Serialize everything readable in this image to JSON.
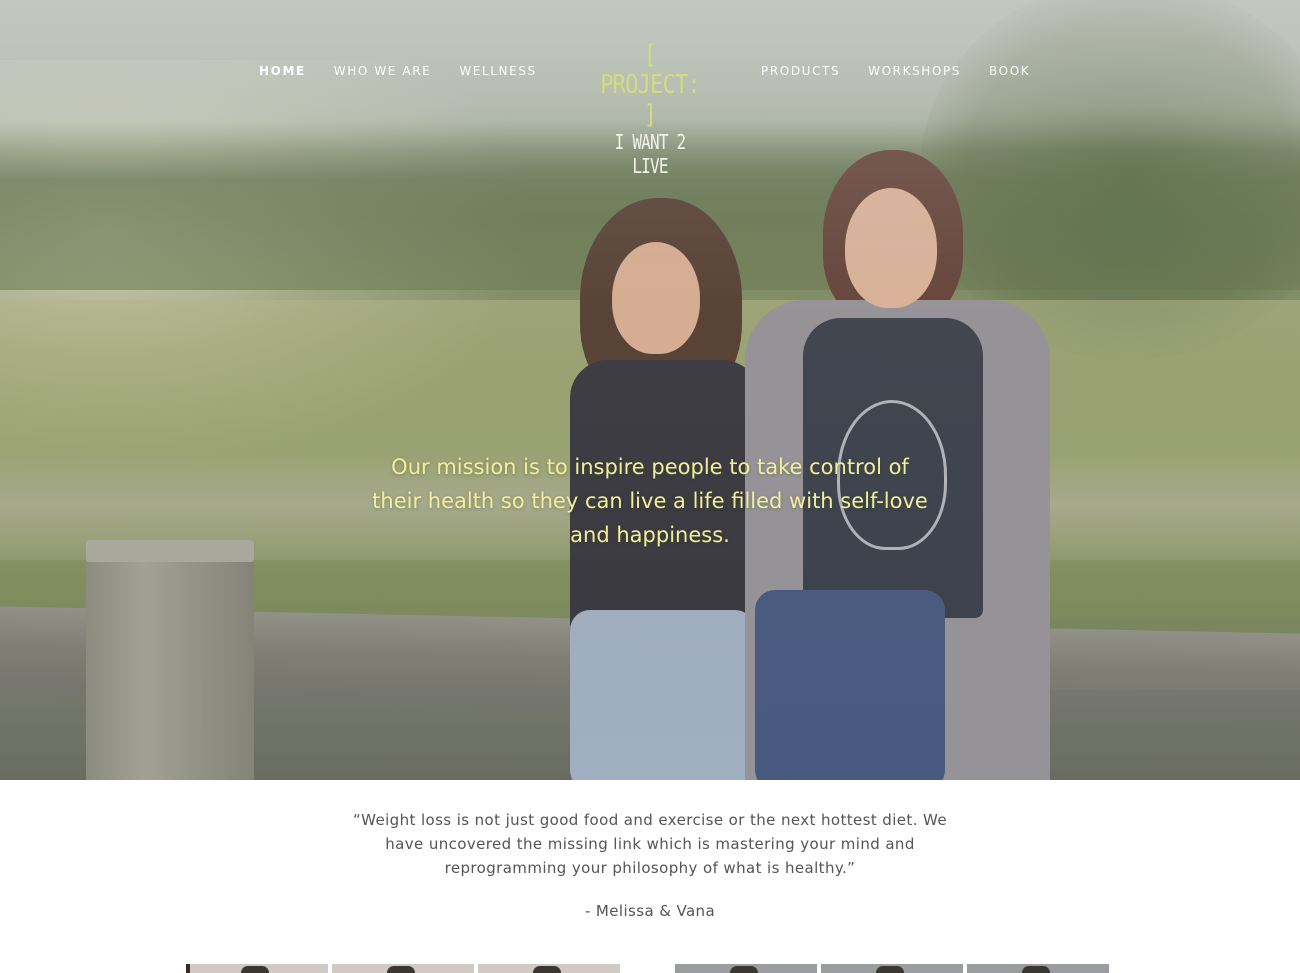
{
  "nav": {
    "left": [
      "HOME",
      "WHO WE ARE",
      "WELLNESS"
    ],
    "right": [
      "PRODUCTS",
      "WORKSHOPS",
      "BOOK"
    ],
    "active": "HOME"
  },
  "logo": {
    "line1": "[ PROJECT: ]",
    "line2": "I WANT 2 LIVE"
  },
  "hero": {
    "mission": "Our mission is to inspire people to take control of their health so they can live a life filled with self-love and happiness."
  },
  "quote": {
    "text": "“Weight loss is not just good food and exercise or the next hottest diet. We have uncovered the missing link which is mastering your mind and reprogramming your philosophy of what is healthy.”",
    "author": "- Melissa & Vana"
  },
  "colors": {
    "logo_accent": "#d3dc7e",
    "mission_text": "#f0ef9a",
    "nav_text": "#ffffff",
    "body_text": "#555555"
  }
}
